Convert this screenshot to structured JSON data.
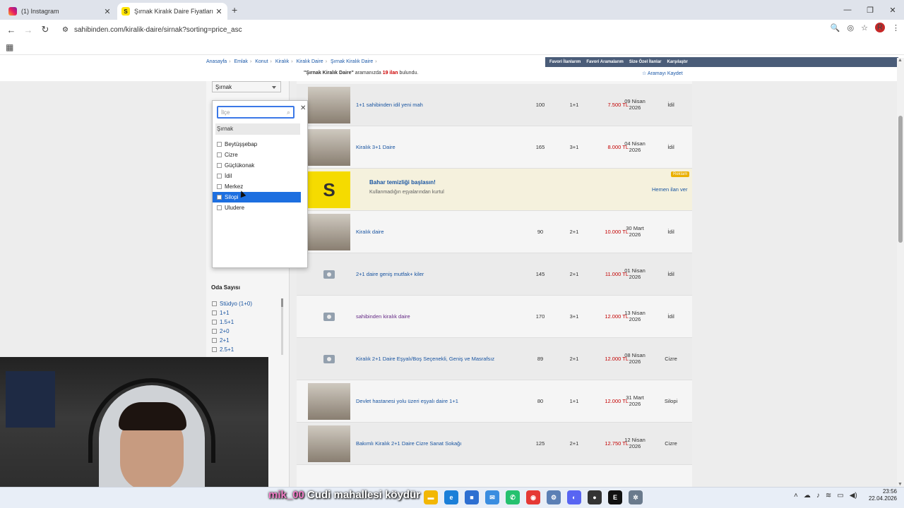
{
  "browser": {
    "tabs": [
      {
        "title": "(1) Instagram",
        "icon": "instagram-icon",
        "active": false
      },
      {
        "title": "Şırnak Kiralık Daire Fiyatları ve",
        "icon": "sahibinden-icon",
        "active": true
      }
    ],
    "url": "sahibinden.com/kiralik-daire/sirnak?sorting=price_asc"
  },
  "page": {
    "breadcrumbs": [
      "Anasayfa",
      "Emlak",
      "Konut",
      "Kiralık",
      "Kiralık Daire",
      "Şırnak Kiralık Daire"
    ],
    "top_links": [
      "Favori İlanlarım",
      "Favori Aramalarım",
      "Size Özel İlanlar",
      "Karşılaştır"
    ],
    "result": {
      "query": "\"Şırnak Kiralık Daire\"",
      "middle": " aramanızda ",
      "count": "19 ilan",
      "suffix": " bulundu."
    },
    "save_search": "☆ Aramayı Kaydet",
    "city_select": "Şırnak",
    "oda_title": "Oda Sayısı",
    "oda_options": [
      "Stüdyo (1+0)",
      "1+1",
      "1.5+1",
      "2+0",
      "2+1",
      "2.5+1"
    ]
  },
  "district_popup": {
    "search_placeholder": "İlçe",
    "group": "Şırnak",
    "options": [
      "Beytüşşebap",
      "Cizre",
      "Güçlükonak",
      "İdil",
      "Merkez",
      "Silopi",
      "Uludere"
    ],
    "highlighted": "Silopi"
  },
  "listings": [
    {
      "title": "1+1 sahibinden idil yeni mah",
      "m2": "100",
      "rooms": "1+1",
      "price": "7.500 TL",
      "date1": "09 Nisan",
      "date2": "2026",
      "location": "İdil",
      "photo": true
    },
    {
      "title": "Kiralık 3+1 Daire",
      "m2": "165",
      "rooms": "3+1",
      "price": "8.000 TL",
      "date1": "04 Nisan",
      "date2": "2026",
      "location": "İdil",
      "photo": true
    },
    {
      "ad": true,
      "head": "Bahar temizliği başlasın!",
      "sub": "Kullanmadığın eşyalarından kurtul",
      "badge": "Reklam",
      "cta": "Hemen ilan ver"
    },
    {
      "title": "Kiralık daire",
      "m2": "90",
      "rooms": "2+1",
      "price": "10.000 TL",
      "date1": "30 Mart",
      "date2": "2026",
      "location": "İdil",
      "photo": true
    },
    {
      "title": "2+1 daire geniş mutfak+ kiler",
      "m2": "145",
      "rooms": "2+1",
      "price": "11.000 TL",
      "date1": "01 Nisan",
      "date2": "2026",
      "location": "İdil",
      "photo": false
    },
    {
      "title": "sahibinden kiralık daire",
      "m2": "170",
      "rooms": "3+1",
      "price": "12.000 TL",
      "date1": "13 Nisan",
      "date2": "2026",
      "location": "İdil",
      "photo": false,
      "visited": true
    },
    {
      "title": "Kiralık 2+1 Daire Eşyalı/Boş Seçenekli, Geniş ve Masrafsız",
      "m2": "89",
      "rooms": "2+1",
      "price": "12.000 TL",
      "date1": "08 Nisan",
      "date2": "2026",
      "location": "Cizre",
      "photo": false
    },
    {
      "title": "Devlet hastanesi yolu üzeri eşyalı daire 1+1",
      "m2": "80",
      "rooms": "1+1",
      "price": "12.000 TL",
      "date1": "31 Mart",
      "date2": "2026",
      "location": "Silopi",
      "photo": true
    },
    {
      "title": "Bakımlı Kiralık 2+1 Daire Cizre Sanat Sokağı",
      "m2": "125",
      "rooms": "2+1",
      "price": "12.750 TL",
      "date1": "12 Nisan",
      "date2": "2026",
      "location": "Cizre",
      "photo": true
    }
  ],
  "taskbar": {
    "overlay_user": "mik_00",
    "overlay_text": " Cudi mahallesi köydür",
    "time": "23:56",
    "date": "22.04.2026"
  }
}
